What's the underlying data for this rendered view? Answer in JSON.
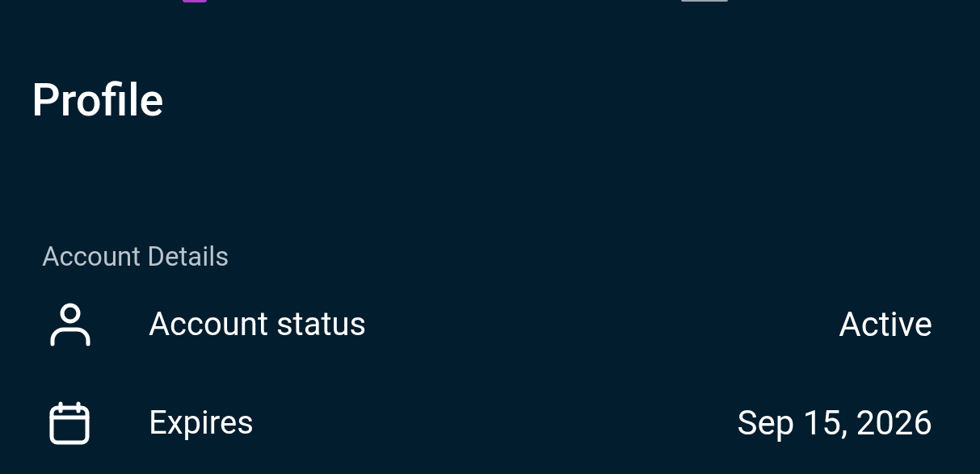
{
  "title": "Profile",
  "section": {
    "heading": "Account Details",
    "rows": [
      {
        "kind": "person",
        "label": "Account status",
        "value": "Active"
      },
      {
        "kind": "calendar",
        "label": "Expires",
        "value": "Sep 15, 2026"
      }
    ]
  }
}
